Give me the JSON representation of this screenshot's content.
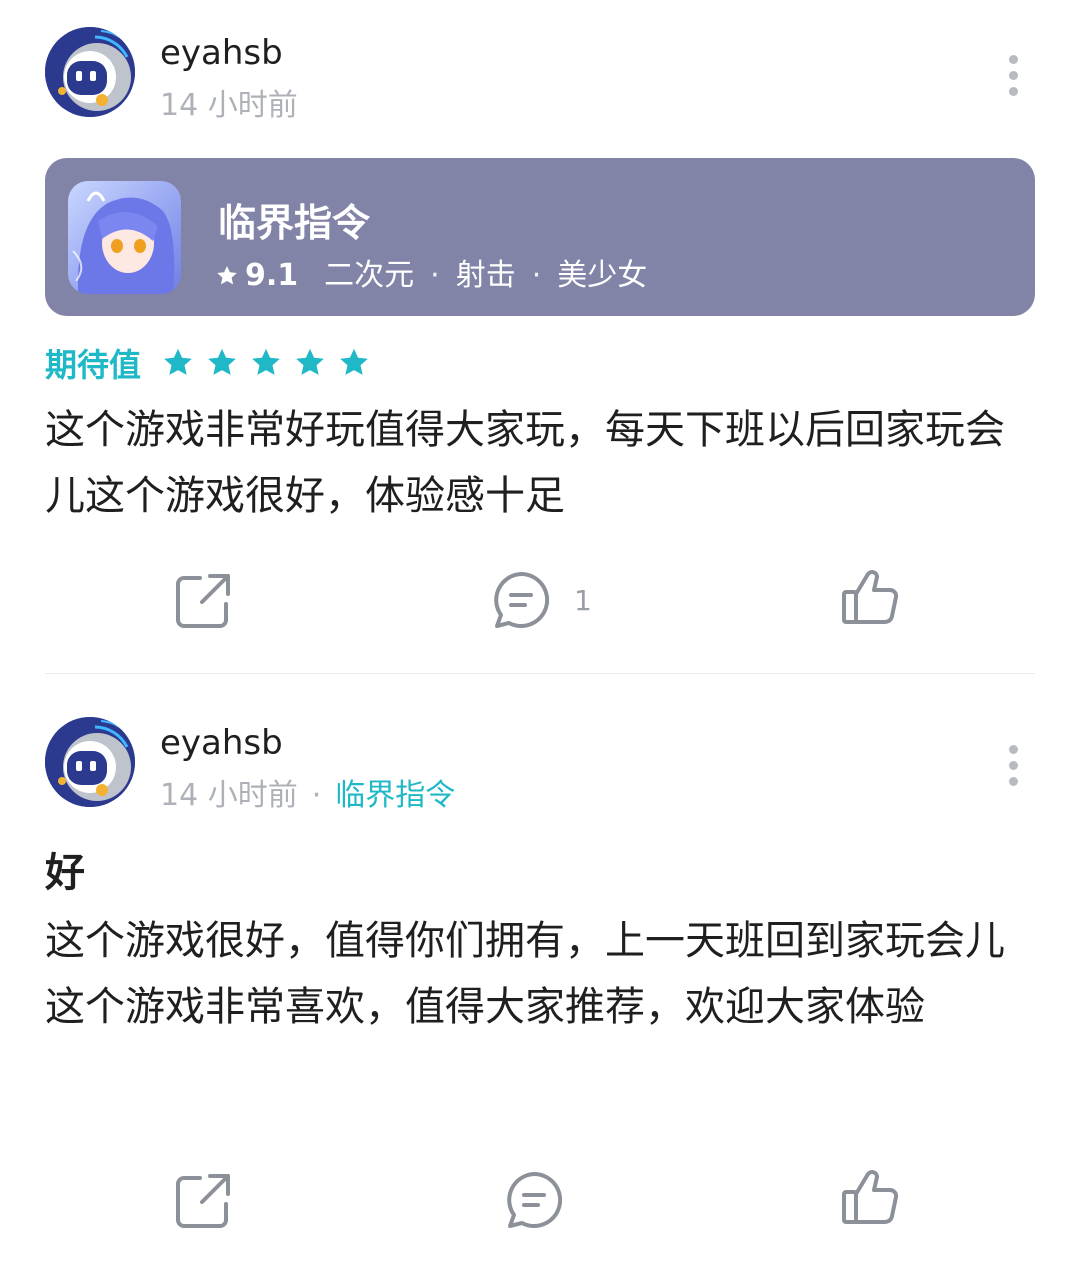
{
  "posts": [
    {
      "username": "eyahsb",
      "time": "14 小时前",
      "game_card": {
        "name": "临界指令",
        "score": "9.1",
        "tags": [
          "二次元",
          "射击",
          "美少女"
        ]
      },
      "rating_label": "期待值",
      "rating_stars": 5,
      "body": "这个游戏非常好玩值得大家玩，每天下班以后回家玩会儿这个游戏很好，体验感十足",
      "comment_count": "1"
    },
    {
      "username": "eyahsb",
      "time": "14 小时前",
      "separator": "·",
      "game_link": "临界指令",
      "title": "好",
      "body": "这个游戏很好，值得你们拥有，上一天班回到家玩会儿这个游戏非常喜欢，值得大家推荐，欢迎大家体验"
    }
  ],
  "icons": {
    "share": "share-icon",
    "comment": "comment-icon",
    "like": "thumbs-up-icon",
    "more": "more-vertical-icon",
    "star": "star-icon"
  },
  "colors": {
    "accent": "#1fb8c7",
    "card_bg": "#8183a7",
    "muted": "#aeb2b8"
  }
}
